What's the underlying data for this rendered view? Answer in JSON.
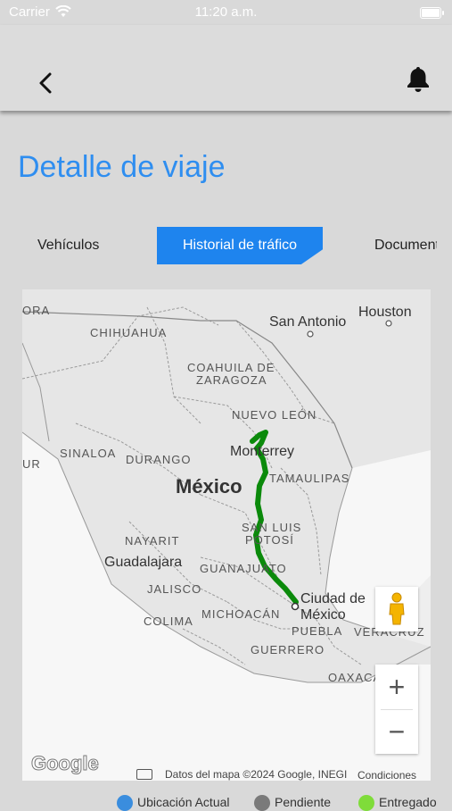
{
  "status_bar": {
    "carrier": "Carrier",
    "time": "11:20 a.m."
  },
  "page": {
    "title": "Detalle de viaje"
  },
  "tabs": [
    {
      "label": "Vehículos"
    },
    {
      "label": "Historial de tráfico",
      "active": true
    },
    {
      "label": "Documentos"
    }
  ],
  "map": {
    "country_label": "México",
    "state_labels": [
      "CHIHUAHUA",
      "COAHUILA DE",
      "ZARAGOZA",
      "NUEVO LEÓN",
      "SINALOA",
      "DURANGO",
      "TAMAULIPAS",
      "SAN LUIS",
      "POTOSÍ",
      "NAYARIT",
      "GUANAJUATO",
      "JALISCO",
      "COLIMA",
      "MICHOACÁN",
      "PUEBLA",
      "VERACRUZ",
      "GUERRERO",
      "OAXACA",
      "ORA",
      "UR"
    ],
    "city_labels": [
      "San Antonio",
      "Houston",
      "Monterrey",
      "Guadalajara",
      "Ciudad de",
      "México"
    ],
    "route_color": "#0b8a0b",
    "attribution": "Datos del mapa ©2024 Google, INEGI",
    "terms": "Condiciones",
    "logo": "Google",
    "zoom_in": "+",
    "zoom_out": "−"
  },
  "legend": [
    {
      "label": "Ubicación Actual",
      "color": "#3a8dde"
    },
    {
      "label": "Pendiente",
      "color": "#7a7a7a"
    },
    {
      "label": "Entregado",
      "color": "#7fdc3a"
    }
  ]
}
